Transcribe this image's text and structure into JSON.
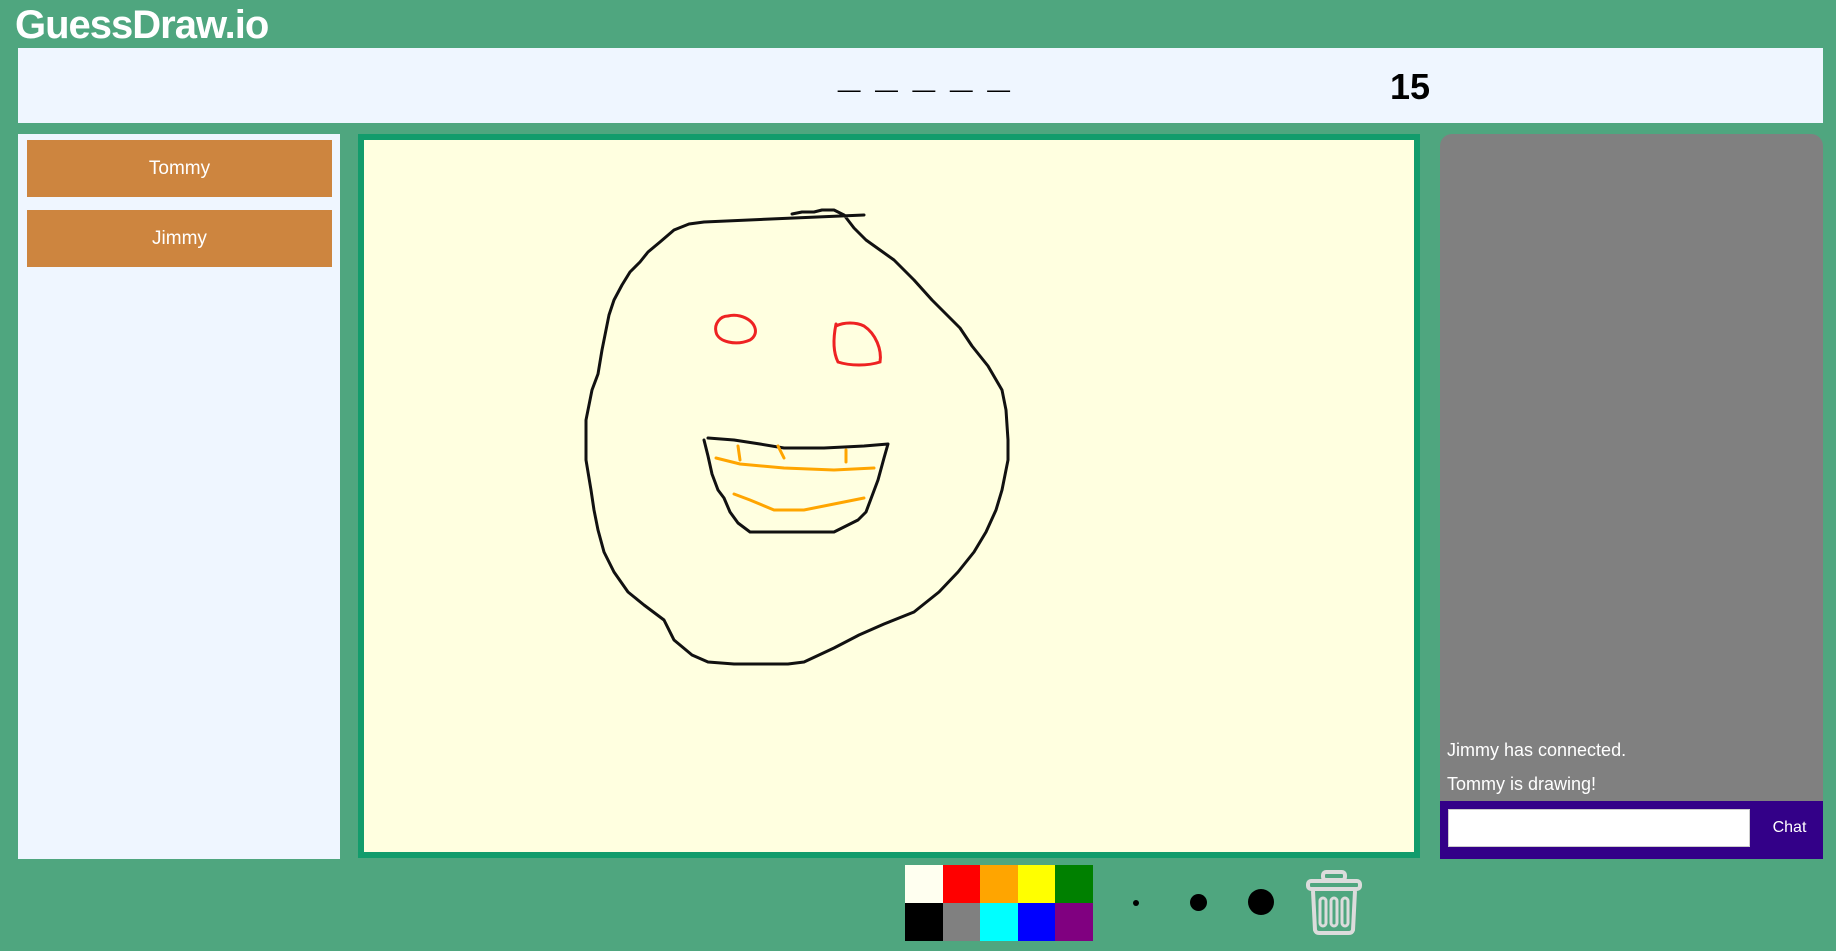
{
  "app": {
    "title": "GuessDraw.io"
  },
  "round": {
    "word_hint": "_ _ _ _ _",
    "timer": "15"
  },
  "players": [
    {
      "name": "Tommy"
    },
    {
      "name": "Jimmy"
    }
  ],
  "chat": {
    "messages": [
      {
        "text": "Jimmy has connected."
      },
      {
        "text": "Tommy is drawing!"
      }
    ],
    "input_value": "",
    "send_label": "Chat"
  },
  "colors": {
    "background": "#4fa67f",
    "board": "#ffffe0",
    "board_border": "#129c6c",
    "player_card": "#cd853f",
    "chat_panel": "#808080",
    "chat_bar": "#330088"
  },
  "palette": [
    {
      "name": "white",
      "hex": "#fffff0"
    },
    {
      "name": "red",
      "hex": "#ff0000"
    },
    {
      "name": "orange",
      "hex": "#ffa500"
    },
    {
      "name": "yellow",
      "hex": "#ffff00"
    },
    {
      "name": "green",
      "hex": "#008000"
    },
    {
      "name": "black",
      "hex": "#000000"
    },
    {
      "name": "gray",
      "hex": "#808080"
    },
    {
      "name": "cyan",
      "hex": "#00ffff"
    },
    {
      "name": "blue",
      "hex": "#0000ff"
    },
    {
      "name": "purple",
      "hex": "#800080"
    }
  ],
  "brush_sizes": [
    "small",
    "medium",
    "large"
  ],
  "icons": {
    "clear": "trash-icon"
  }
}
